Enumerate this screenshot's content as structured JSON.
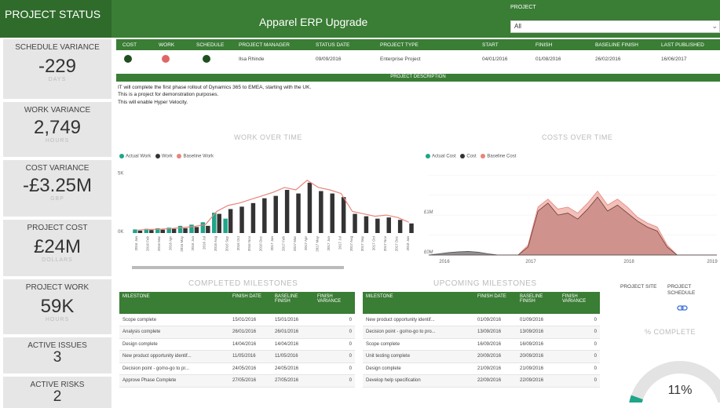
{
  "header": {
    "left_title": "PROJECT STATUS",
    "title": "Apparel ERP Upgrade",
    "project_label": "PROJECT",
    "project_value": "All"
  },
  "kpis": [
    {
      "title": "SCHEDULE VARIANCE",
      "value": "-229",
      "unit": "DAYS"
    },
    {
      "title": "WORK VARIANCE",
      "value": "2,749",
      "unit": "HOURS"
    },
    {
      "title": "COST VARIANCE",
      "value": "-£3.25M",
      "unit": "GBP"
    },
    {
      "title": "PROJECT COST",
      "value": "£24M",
      "unit": "DOLLARS"
    },
    {
      "title": "PROJECT WORK",
      "value": "59K",
      "unit": "HOURS"
    },
    {
      "title": "ACTIVE ISSUES",
      "value": "3",
      "unit": ""
    },
    {
      "title": "ACTIVE RISKS",
      "value": "2",
      "unit": ""
    }
  ],
  "status_table": {
    "headers": [
      "COST",
      "WORK",
      "SCHEDULE",
      "PROJECT MANAGER",
      "STATUS DATE",
      "PROJECT TYPE",
      "START",
      "FINISH",
      "BASELINE FINISH",
      "LAST PUBLISHED"
    ],
    "row": {
      "manager": "Ilsa Rhinde",
      "status_date": "09/09/2016",
      "type": "Enterprise Project",
      "start": "04/01/2016",
      "finish": "01/08/2016",
      "baseline_finish": "26/02/2016",
      "last_published": "16/06/2017"
    },
    "indicator_colors": {
      "cost": "#1f4f1f",
      "work": "#e06666",
      "schedule": "#1f4f1f"
    }
  },
  "description": {
    "header": "PROJECT DESCRIPTION",
    "lines": [
      "IT will complete the first phase rollout of Dynamics 365 to EMEA, starting with the UK.",
      "This is a project for demonstration purposes.",
      "This will enable Hyper Velocity."
    ]
  },
  "charts": {
    "work_title": "WORK OVER TIME",
    "work_legend": [
      "Actual Work",
      "Work",
      "Baseline Work"
    ],
    "cost_title": "COSTS OVER TIME",
    "cost_legend": [
      "Actual Cost",
      "Cost",
      "Baseline Cost"
    ]
  },
  "chart_data": [
    {
      "type": "bar",
      "title": "WORK OVER TIME",
      "categories": [
        "2016 Jan",
        "2016 Feb",
        "2016 Mar",
        "2016 Apr",
        "2016 May",
        "2016 Jun",
        "2016 Jul",
        "2016 Aug",
        "2016 Sep",
        "2016 Oct",
        "2016 Nov",
        "2016 Dec",
        "2017 Jan",
        "2017 Feb",
        "2017 Mar",
        "2017 Apr",
        "2017 May",
        "2017 Jun",
        "2017 Jul",
        "2017 Aug",
        "2017 Sep",
        "2017 Oct",
        "2017 Nov",
        "2017 Dec",
        "2018 Jan"
      ],
      "yticks": [
        "5K",
        "0K"
      ],
      "ylim": [
        0,
        5500
      ],
      "series": [
        {
          "name": "Actual Work",
          "values": [
            300,
            350,
            400,
            450,
            600,
            700,
            900,
            1700,
            1200,
            0,
            0,
            0,
            0,
            0,
            0,
            0,
            0,
            0,
            0,
            0,
            0,
            0,
            0,
            0,
            0
          ]
        },
        {
          "name": "Work",
          "values": [
            200,
            250,
            280,
            350,
            400,
            500,
            600,
            1600,
            2000,
            2200,
            2500,
            2900,
            3100,
            3600,
            3300,
            4200,
            3500,
            3300,
            3000,
            1600,
            1400,
            1200,
            1300,
            1100,
            800
          ]
        },
        {
          "name": "Baseline Work",
          "values": [
            250,
            300,
            320,
            380,
            450,
            550,
            700,
            1800,
            2300,
            2500,
            2800,
            3100,
            3400,
            3800,
            3600,
            4400,
            3800,
            3600,
            3300,
            1800,
            1600,
            1400,
            1500,
            1300,
            900
          ]
        }
      ]
    },
    {
      "type": "area",
      "title": "COSTS OVER TIME",
      "x": [
        "2016",
        "2017",
        "2018",
        "2019"
      ],
      "yticks": [
        "£1M",
        "£0M"
      ],
      "ylim": [
        0,
        2200000
      ],
      "series": [
        {
          "name": "Actual Cost",
          "values": [
            0,
            30000,
            60000,
            80000,
            90000,
            70000,
            30000,
            0,
            0,
            0,
            0,
            0,
            0,
            0,
            0,
            0,
            0,
            0,
            0,
            0,
            0,
            0,
            0,
            0,
            0,
            0,
            0,
            0,
            0,
            0
          ]
        },
        {
          "name": "Cost",
          "values": [
            0,
            0,
            0,
            0,
            0,
            0,
            0,
            0,
            0,
            0,
            200000,
            1100000,
            1300000,
            1000000,
            1050000,
            900000,
            1150000,
            1450000,
            1100000,
            1250000,
            1050000,
            850000,
            700000,
            600000,
            200000,
            0,
            0,
            0,
            0,
            0
          ]
        },
        {
          "name": "Baseline Cost",
          "values": [
            0,
            0,
            0,
            0,
            0,
            0,
            0,
            0,
            0,
            0,
            250000,
            1200000,
            1400000,
            1150000,
            1200000,
            1050000,
            1300000,
            1600000,
            1250000,
            1400000,
            1200000,
            950000,
            800000,
            700000,
            250000,
            0,
            0,
            0,
            0,
            0
          ]
        }
      ]
    }
  ],
  "completed": {
    "title": "COMPLETED MILESTONES",
    "headers": [
      "MILESTONE",
      "FINISH DATE",
      "BASELINE FINISH",
      "FINISH VARIANCE"
    ],
    "rows": [
      [
        "Scope complete",
        "15/01/2016",
        "15/01/2016",
        "0"
      ],
      [
        "Analysis complete",
        "26/01/2016",
        "26/01/2016",
        "0"
      ],
      [
        "Design complete",
        "14/04/2016",
        "14/04/2016",
        "0"
      ],
      [
        "New product opportunity identif...",
        "11/05/2016",
        "11/05/2016",
        "0"
      ],
      [
        "Decision point - go/no-go to pr...",
        "24/05/2016",
        "24/05/2016",
        "0"
      ],
      [
        "Approve Phase Complete",
        "27/05/2016",
        "27/05/2016",
        "0"
      ]
    ]
  },
  "upcoming": {
    "title": "UPCOMING MILESTONES",
    "headers": [
      "MILESTONE",
      "FINISH DATE",
      "BASELINE FINISH",
      "FINISH VARIANCE"
    ],
    "rows": [
      [
        "New product opportunity identif...",
        "01/09/2016",
        "01/09/2016",
        "0"
      ],
      [
        "Decision point - go/no-go to pro...",
        "13/09/2016",
        "13/09/2016",
        "0"
      ],
      [
        "Scope complete",
        "16/09/2016",
        "16/09/2016",
        "0"
      ],
      [
        "Unit testing complete",
        "20/09/2016",
        "20/09/2016",
        "0"
      ],
      [
        "Design complete",
        "21/09/2016",
        "21/09/2016",
        "0"
      ],
      [
        "Develop help specification",
        "22/09/2016",
        "22/09/2016",
        "0"
      ]
    ]
  },
  "links": {
    "site": "PROJECT SITE",
    "schedule": "PROJECT SCHEDULE"
  },
  "percent_complete": {
    "title": "% COMPLETE",
    "value": 0.11,
    "label": "11%"
  },
  "colors": {
    "green": "#3a7d35",
    "dark_bar": "#333333",
    "teal": "#1fa58a",
    "salmon": "#e8847a",
    "area_fill": "#d9a09a"
  }
}
